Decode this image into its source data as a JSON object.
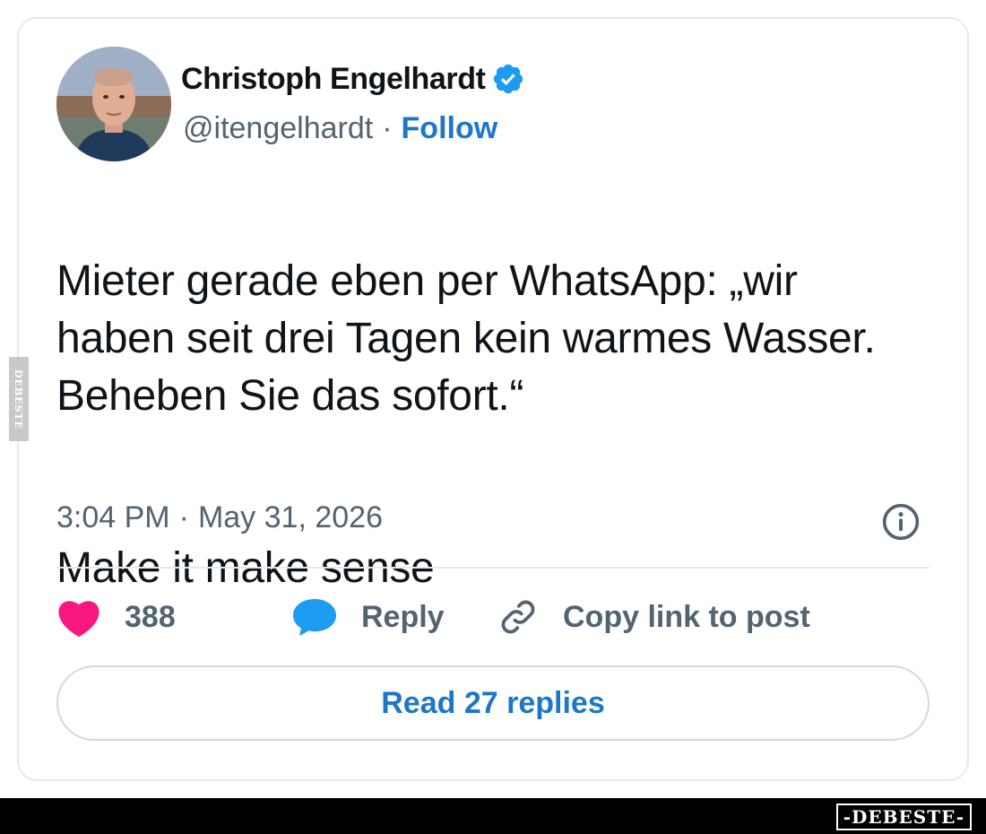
{
  "author": {
    "name": "Christoph Engelhardt",
    "handle": "@itengelhardt",
    "separator": "·",
    "follow_label": "Follow",
    "verified": true
  },
  "tweet": {
    "paragraph1": "Mieter gerade eben per WhatsApp: „wir haben seit drei Tagen kein warmes Wasser. Beheben Sie das sofort.“",
    "paragraph2": "Make it make sense"
  },
  "meta": {
    "time": "3:04 PM",
    "separator": "·",
    "date": "May 31, 2026"
  },
  "actions": {
    "like_count": "388",
    "reply_label": "Reply",
    "copy_link_label": "Copy link to post"
  },
  "read_replies_label": "Read 27 replies",
  "watermark": {
    "side_text": "DEBESTE",
    "footer_text": "-DEBESTE-"
  },
  "colors": {
    "link_blue": "#1d77c9",
    "verified_blue": "#1d9bf0",
    "heart_pink": "#f91880",
    "reply_blue": "#1d9bf0",
    "secondary_text": "#536471"
  },
  "icons": [
    "verified-badge-icon",
    "info-icon",
    "heart-icon",
    "reply-bubble-icon",
    "link-icon"
  ]
}
